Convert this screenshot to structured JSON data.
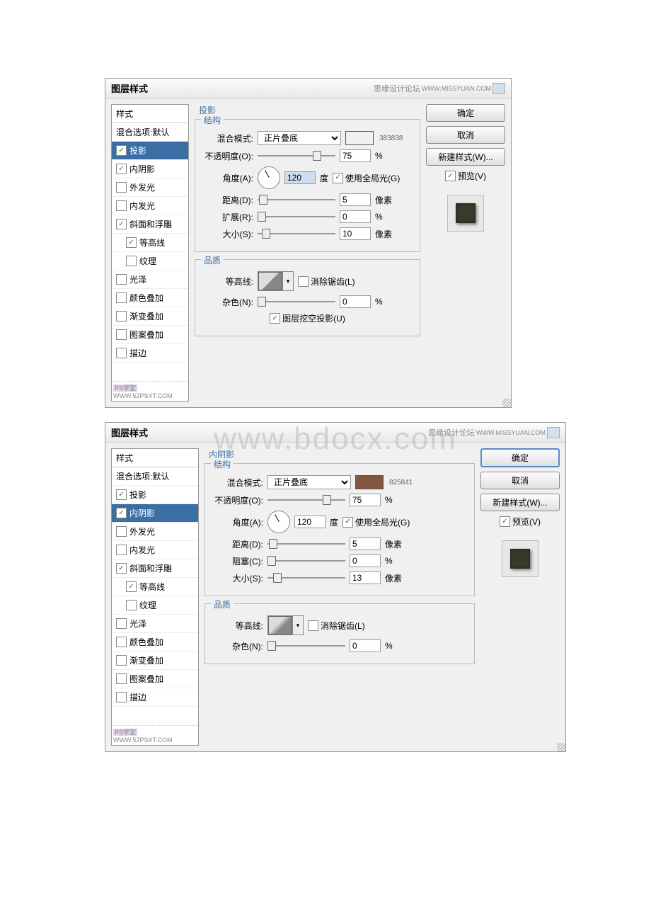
{
  "dialog_title": "图层样式",
  "watermark_top_text": "思缘设计论坛",
  "watermark_top_url1": "WWW.MISSYUAN.COM",
  "watermark_big": "www.bdocx.com",
  "watermark_bottom": "PS学堂",
  "watermark_bottom_url": "WWW.52PSXT.COM",
  "sidebar": {
    "header": "样式",
    "blend_default": "混合选项:默认",
    "items": [
      {
        "label": "投影",
        "checked": true,
        "selected_in": 1
      },
      {
        "label": "内阴影",
        "checked": true,
        "selected_in": 2
      },
      {
        "label": "外发光",
        "checked": false
      },
      {
        "label": "内发光",
        "checked": false
      },
      {
        "label": "斜面和浮雕",
        "checked": true
      },
      {
        "label": "等高线",
        "checked": true,
        "indent": true
      },
      {
        "label": "纹理",
        "checked": false,
        "indent": true
      },
      {
        "label": "光泽",
        "checked": false
      },
      {
        "label": "颜色叠加",
        "checked": false
      },
      {
        "label": "渐变叠加",
        "checked": false
      },
      {
        "label": "图案叠加",
        "checked": false
      },
      {
        "label": "描边",
        "checked": false
      }
    ]
  },
  "buttons": {
    "ok": "确定",
    "cancel": "取消",
    "new_style": "新建样式(W)...",
    "preview": "预览(V)"
  },
  "labels": {
    "structure": "结构",
    "quality": "品质",
    "blend_mode": "混合模式:",
    "opacity": "不透明度(O):",
    "angle": "角度(A):",
    "degree": "度",
    "use_global": "使用全局光(G)",
    "distance": "距离(D):",
    "spread": "扩展(R):",
    "choke": "阻塞(C):",
    "size": "大小(S):",
    "px": "像素",
    "pct": "%",
    "contour": "等高线:",
    "antialias": "消除锯齿(L)",
    "noise": "杂色(N):",
    "knockout": "图层挖空投影(U)"
  },
  "panel1": {
    "section_title": "投影",
    "blend_mode_value": "正片叠底",
    "color_code": "383838",
    "color": "#383838",
    "opacity": "75",
    "angle": "120",
    "use_global": true,
    "distance": "5",
    "spread": "0",
    "size": "10",
    "antialias": false,
    "noise": "0",
    "knockout": true
  },
  "panel2": {
    "section_title": "内阴影",
    "blend_mode_value": "正片叠底",
    "color_code": "825841",
    "color": "#825841",
    "opacity": "75",
    "angle": "120",
    "use_global": true,
    "distance": "5",
    "choke": "0",
    "size": "13",
    "antialias": false,
    "noise": "0"
  }
}
